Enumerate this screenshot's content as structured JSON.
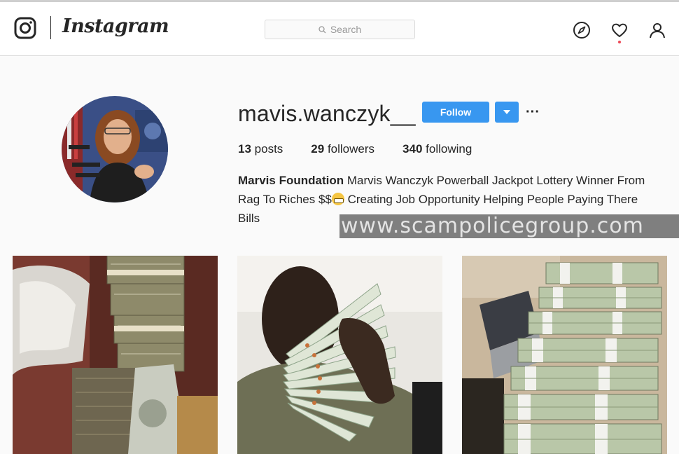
{
  "app": {
    "wordmark": "Instagram",
    "logo_icon": "instagram-camera-icon"
  },
  "search": {
    "placeholder": "Search",
    "icon": "search-icon"
  },
  "nav": {
    "icons": [
      "compass-icon",
      "heart-icon",
      "profile-icon"
    ],
    "has_notification": true
  },
  "profile": {
    "username": "mavis.wanczyk__",
    "follow_label": "Follow",
    "dropdown_icon": "caret-down-icon",
    "more_icon": "ellipsis-icon",
    "more_label": "···",
    "stats": {
      "posts_count": "13",
      "posts_label": "posts",
      "followers_count": "29",
      "followers_label": "followers",
      "following_count": "340",
      "following_label": "following"
    },
    "bio": {
      "name": "Marvis Foundation",
      "text_part1": "Marvis Wanczyk Powerball Jackpot Lottery Winner From Rag To Riches $$",
      "text_part2": "Creating Job Opportunity Helping People Paying There Bills"
    }
  },
  "watermark": "www.scampolicegroup.com",
  "posts": [
    {
      "alt": "stacks of cash bundles"
    },
    {
      "alt": "person holding fanned cash"
    },
    {
      "alt": "table of banded money stacks"
    }
  ],
  "colors": {
    "accent": "#3897f0",
    "text": "#262626",
    "border": "#dbdbdb",
    "background": "#fafafa",
    "notification": "#ed4956"
  }
}
